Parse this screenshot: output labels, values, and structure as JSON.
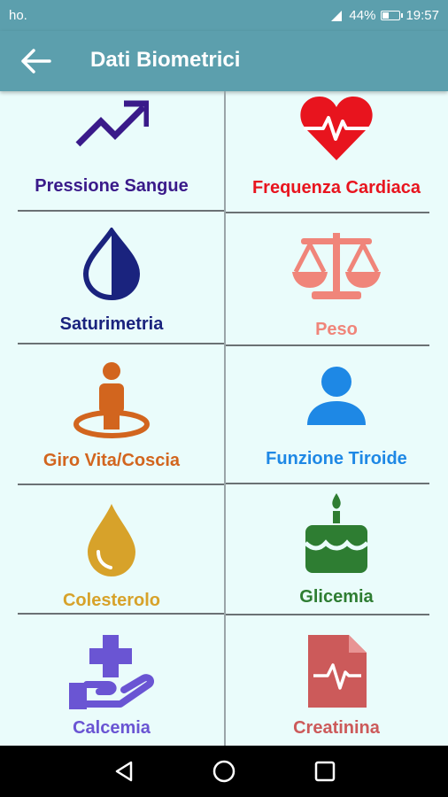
{
  "status": {
    "carrier": "ho.",
    "battery": "44%",
    "battery_level": 44,
    "time": "19:57"
  },
  "app_bar": {
    "title": "Dati Biometrici"
  },
  "colors": {
    "primary": "#5c9fad",
    "pressione": "#3a1a8a",
    "frequenza": "#e8141e",
    "saturimetria": "#1a237e",
    "peso": "#f0857a",
    "giro": "#d2651e",
    "tiroide": "#1e88e5",
    "colesterolo": "#d7a22a",
    "glicemia": "#2e7d32",
    "calcemia": "#6a55d3",
    "creatinina": "#cc5a5a"
  },
  "items": [
    {
      "label": "Pressione Sangue",
      "icon": "trending-up-icon"
    },
    {
      "label": "Frequenza Cardiaca",
      "icon": "heart-pulse-icon"
    },
    {
      "label": "Saturimetria",
      "icon": "drop-half-icon"
    },
    {
      "label": "Peso",
      "icon": "balance-scale-icon"
    },
    {
      "label": "Giro Vita/Coscia",
      "icon": "person-pin-icon"
    },
    {
      "label": "Funzione Tiroide",
      "icon": "person-icon"
    },
    {
      "label": "Colesterolo",
      "icon": "oil-drop-icon"
    },
    {
      "label": "Glicemia",
      "icon": "cake-icon"
    },
    {
      "label": "Calcemia",
      "icon": "hand-plus-icon"
    },
    {
      "label": "Creatinina",
      "icon": "medical-file-icon"
    }
  ],
  "nav": {
    "back": "back-triangle-icon",
    "home": "home-circle-icon",
    "recents": "recents-square-icon"
  }
}
